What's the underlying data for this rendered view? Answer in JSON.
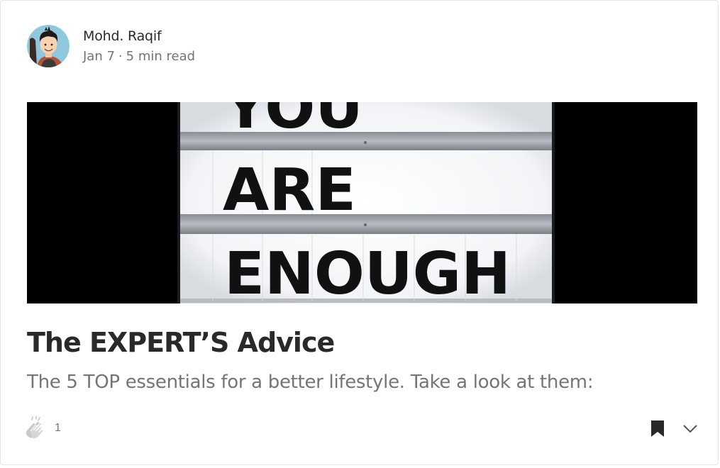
{
  "author": {
    "name": "Mohd. Raqif",
    "date": "Jan 7",
    "separator": "·",
    "read_time": "5 min read"
  },
  "hero_image": {
    "sign_lines": [
      "YOU",
      "ARE",
      "ENOUGH"
    ]
  },
  "post": {
    "title": "The EXPERT’S Advice",
    "subtitle": "The 5 TOP essentials for a better lifestyle. Take a look at them:"
  },
  "actions": {
    "clap_count": "1",
    "clap_icon": "clap-icon",
    "bookmark_icon": "bookmark-icon",
    "more_icon": "chevron-down-icon"
  }
}
